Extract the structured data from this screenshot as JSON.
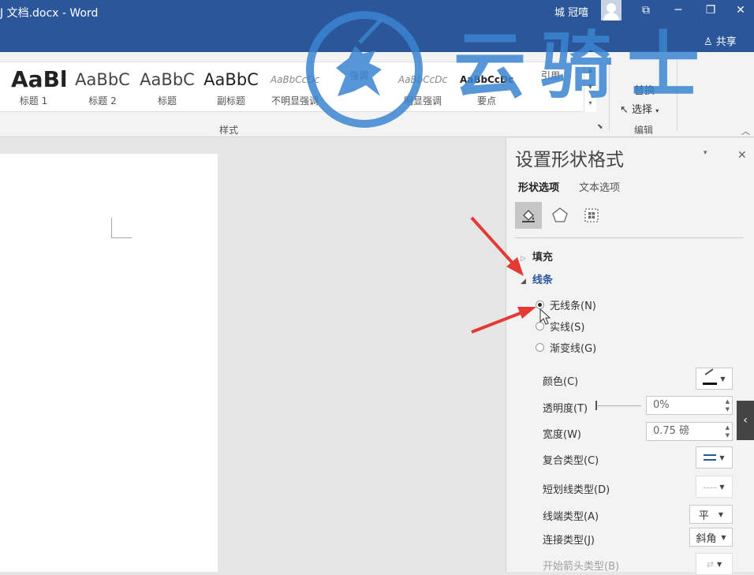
{
  "titlebar": {
    "doc_title": "J 文档.docx - Word",
    "user_name": "城 冠嘻",
    "share_label": "共享",
    "buttons": {
      "ribbon_display": "⧉",
      "minimize": "─",
      "restore": "❐",
      "close": "✕"
    }
  },
  "ribbon": {
    "styles": [
      {
        "preview": "AaBl",
        "name": "标题 1"
      },
      {
        "preview": "AaBbC",
        "name": "标题 2"
      },
      {
        "preview": "AaBbC",
        "name": "标题"
      },
      {
        "preview": "AaBbC",
        "name": "副标题"
      },
      {
        "preview": "AaBbCcDc",
        "name": "不明显强调"
      },
      {
        "preview": "",
        "name": "强调"
      },
      {
        "preview": "AaBbCcDc",
        "name": "明显强调"
      },
      {
        "preview": "AaBbCcDc",
        "name": "要点"
      },
      {
        "preview": "",
        "name": "引用"
      }
    ],
    "styles_group_label": "样式",
    "edit_replace_label": "替换",
    "edit_select_label": "选择",
    "edit_group_label": "编辑"
  },
  "pane": {
    "title": "设置形状格式",
    "tabs": [
      "形状选项",
      "文本选项"
    ],
    "sections": {
      "fill": "填充",
      "line": "线条"
    },
    "line_options": [
      {
        "label": "无线条(N)",
        "selected": true
      },
      {
        "label": "实线(S)",
        "selected": false
      },
      {
        "label": "渐变线(G)",
        "selected": false
      }
    ],
    "props": {
      "color_label": "颜色(C)",
      "transparency_label": "透明度(T)",
      "transparency_value": "0%",
      "width_label": "宽度(W)",
      "width_value": "0.75 磅",
      "compound_label": "复合类型(C)",
      "dash_label": "短划线类型(D)",
      "cap_label": "线端类型(A)",
      "cap_value": "平",
      "join_label": "连接类型(J)",
      "join_value": "斜角",
      "begin_arrow_label": "开始箭头类型(B)"
    }
  },
  "watermark": {
    "text": "云骑士"
  },
  "colors": {
    "titlebar": "#2b579a",
    "accent": "#2b579a",
    "watermark": "#3984d0",
    "annotation_arrow": "#e53935"
  }
}
